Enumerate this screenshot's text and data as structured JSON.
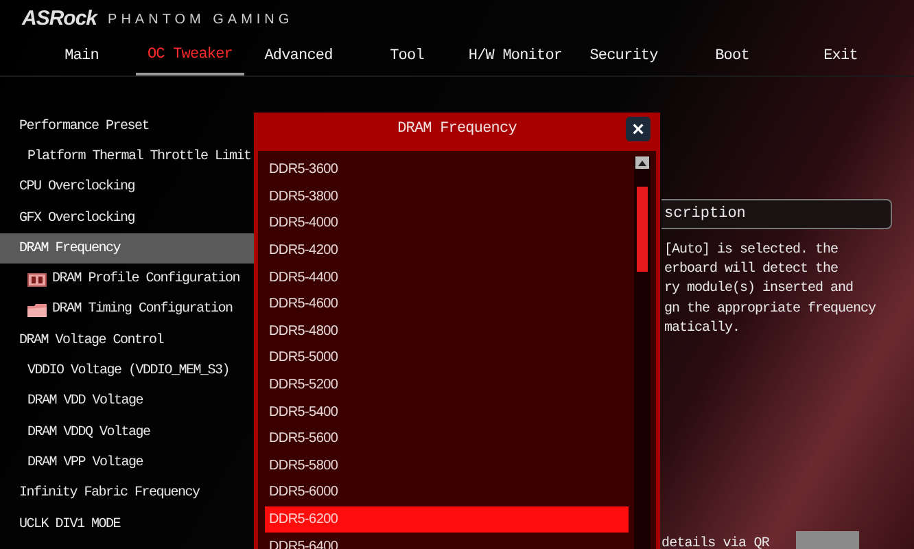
{
  "brand": {
    "logo": "ASRock",
    "subtitle": "PHANTOM GAMING"
  },
  "tabs": [
    {
      "label": "Main",
      "selected": false
    },
    {
      "label": "OC Tweaker",
      "selected": true
    },
    {
      "label": "Advanced",
      "selected": false
    },
    {
      "label": "Tool",
      "selected": false
    },
    {
      "label": "H/W Monitor",
      "selected": false
    },
    {
      "label": "Security",
      "selected": false
    },
    {
      "label": "Boot",
      "selected": false
    },
    {
      "label": "Exit",
      "selected": false
    }
  ],
  "menu": [
    {
      "label": "Performance Preset",
      "kind": "item",
      "selected": false,
      "children": [
        {
          "label": "Platform Thermal Throttle Limit",
          "kind": "item",
          "selected": false
        }
      ]
    },
    {
      "label": "CPU Overclocking",
      "kind": "item",
      "selected": false
    },
    {
      "label": "GFX Overclocking",
      "kind": "item",
      "selected": false
    },
    {
      "label": "DRAM Frequency",
      "kind": "item",
      "selected": true
    },
    {
      "label": "DRAM Profile Configuration",
      "kind": "memory-link",
      "selected": false
    },
    {
      "label": "DRAM Timing Configuration",
      "kind": "folder-link",
      "selected": false
    },
    {
      "label": "DRAM Voltage Control",
      "kind": "item",
      "selected": false,
      "children": [
        {
          "label": "VDDIO Voltage (VDDIO_MEM_S3)",
          "kind": "item",
          "selected": false
        },
        {
          "label": "DRAM VDD Voltage",
          "kind": "item",
          "selected": false
        },
        {
          "label": "DRAM VDDQ Voltage",
          "kind": "item",
          "selected": false
        },
        {
          "label": "DRAM VPP Voltage",
          "kind": "item",
          "selected": false
        }
      ]
    },
    {
      "label": "Infinity Fabric Frequency",
      "kind": "item",
      "selected": false
    },
    {
      "label": "UCLK DIV1 MODE",
      "kind": "item",
      "selected": false
    }
  ],
  "description": {
    "title": "scription",
    "lines": [
      "[Auto] is selected. the",
      "erboard will detect the",
      "ry module(s) inserted and",
      "gn the appropriate frequency",
      "matically."
    ],
    "qr_note": "details via QR"
  },
  "dialog": {
    "title": "DRAM Frequency",
    "close": "×",
    "options": [
      {
        "label": "DDR5-3600",
        "selected": false
      },
      {
        "label": "DDR5-3800",
        "selected": false
      },
      {
        "label": "DDR5-4000",
        "selected": false
      },
      {
        "label": "DDR5-4200",
        "selected": false
      },
      {
        "label": "DDR5-4400",
        "selected": false
      },
      {
        "label": "DDR5-4600",
        "selected": false
      },
      {
        "label": "DDR5-4800",
        "selected": false
      },
      {
        "label": "DDR5-5000",
        "selected": false
      },
      {
        "label": "DDR5-5200",
        "selected": false
      },
      {
        "label": "DDR5-5400",
        "selected": false
      },
      {
        "label": "DDR5-5600",
        "selected": false
      },
      {
        "label": "DDR5-5800",
        "selected": false
      },
      {
        "label": "DDR5-6000",
        "selected": false
      },
      {
        "label": "DDR5-6200",
        "selected": true
      },
      {
        "label": "DDR5-6400",
        "selected": false
      }
    ]
  }
}
